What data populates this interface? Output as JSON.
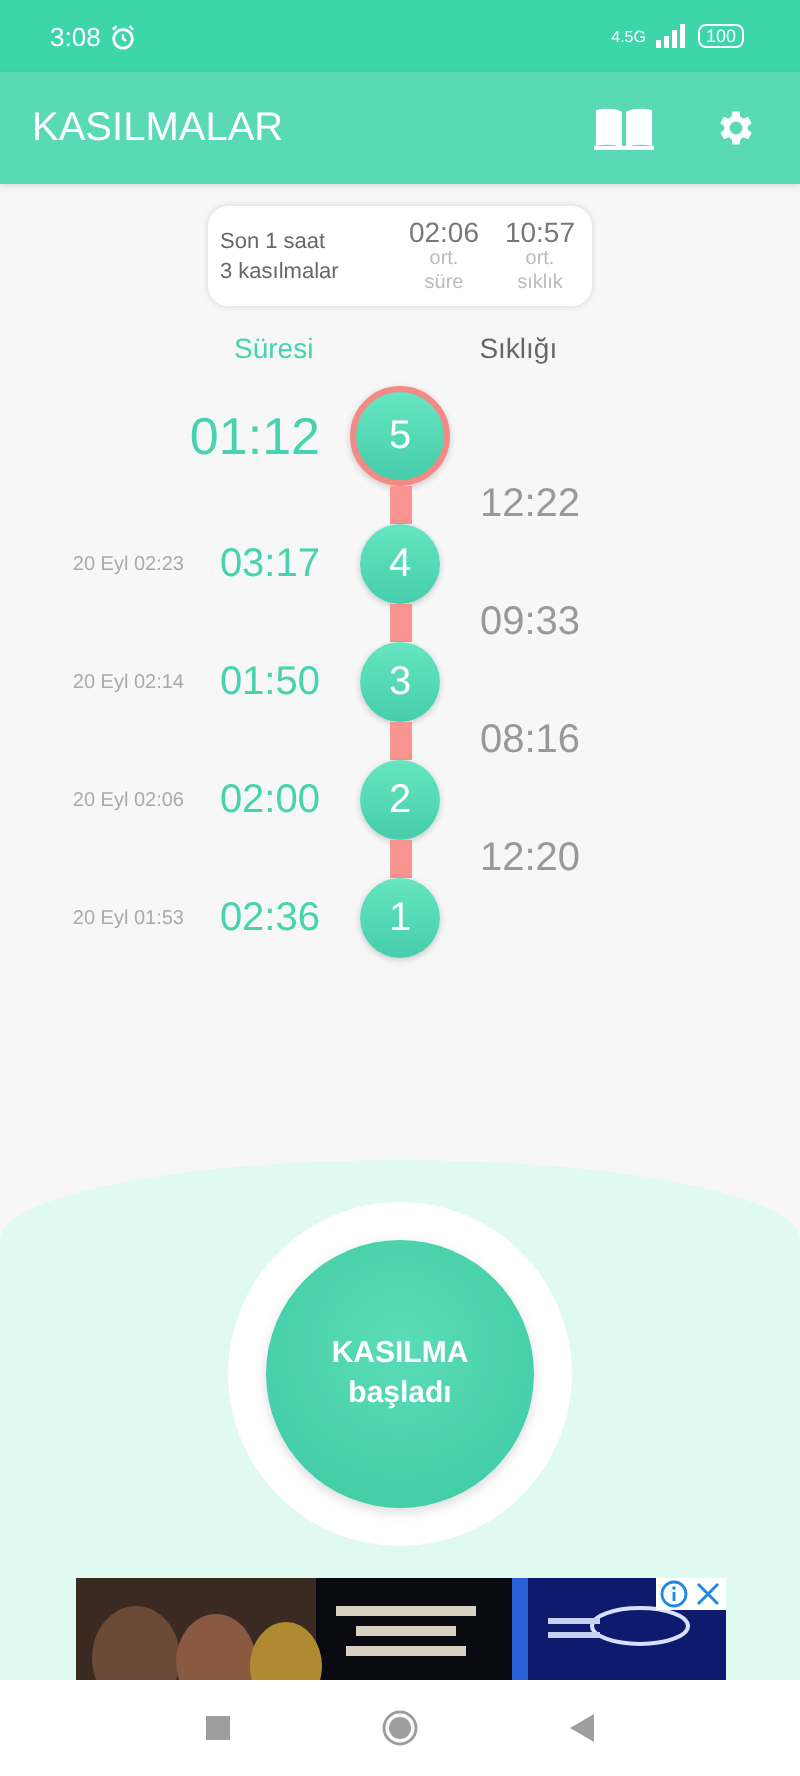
{
  "status_bar": {
    "time": "3:08",
    "battery": "100",
    "network": "4.5G"
  },
  "app_bar": {
    "title": "KASILMALAR"
  },
  "summary": {
    "period": "Son 1 saat",
    "count": "3 kasılmalar",
    "stats": [
      {
        "value": "02:06",
        "label": "ort. süre"
      },
      {
        "value": "10:57",
        "label": "ort. sıklık"
      }
    ]
  },
  "headings": {
    "duration": "Süresi",
    "frequency": "Sıklığı"
  },
  "contractions": [
    {
      "number": "5",
      "duration": "01:12",
      "selected": true,
      "interval": "12:22"
    },
    {
      "number": "4",
      "date": "20 Eyl 02:23",
      "duration": "03:17",
      "selected": false,
      "interval": "09:33"
    },
    {
      "number": "3",
      "date": "20 Eyl 02:14",
      "duration": "01:50",
      "selected": false,
      "interval": "08:16"
    },
    {
      "number": "2",
      "date": "20 Eyl 02:06",
      "duration": "02:00",
      "selected": false,
      "interval": "12:20"
    },
    {
      "number": "1",
      "date": "20 Eyl 01:53",
      "duration": "02:36",
      "selected": false
    }
  ],
  "start_button": {
    "line1": "KASILMA",
    "line2": "başladı"
  }
}
